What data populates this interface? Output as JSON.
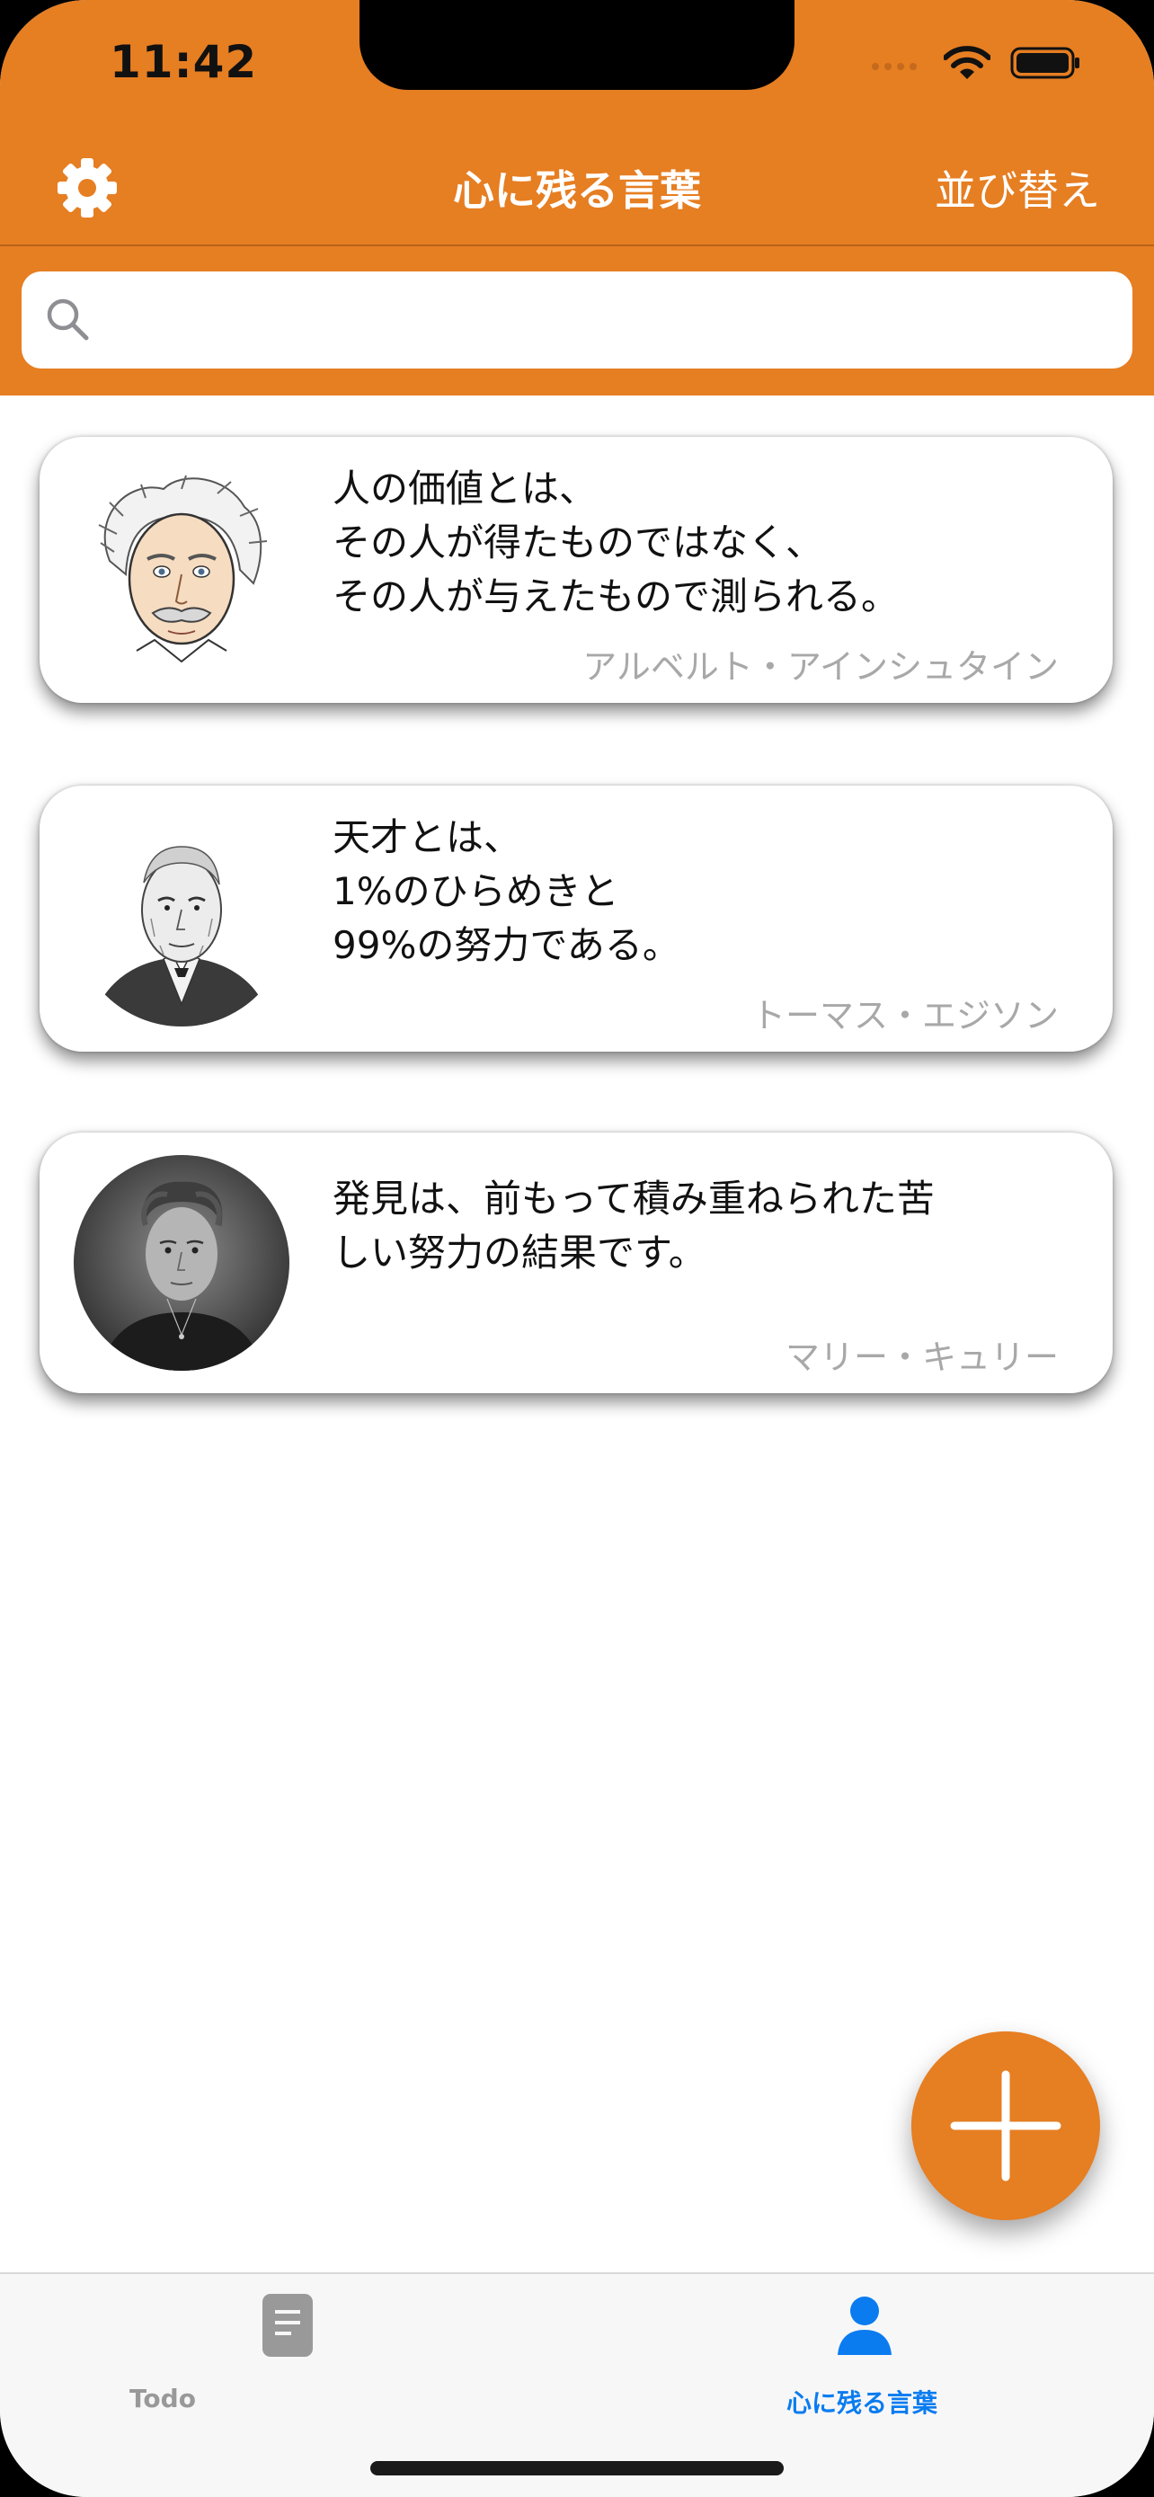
{
  "status_bar": {
    "time": "11:42"
  },
  "nav": {
    "title": "心に残る言葉",
    "sort_label": "並び替え"
  },
  "search": {
    "value": "",
    "placeholder": ""
  },
  "quotes": [
    {
      "lines": [
        "人の価値とは、",
        "その人が得たものではなく、",
        "その人が与えたもので測られる。"
      ],
      "author": "アルベルト・アインシュタイン"
    },
    {
      "lines": [
        "天才とは、",
        "1%のひらめきと",
        "99%の努力である。"
      ],
      "author": "トーマス・エジソン"
    },
    {
      "lines": [
        "発見は、前もって積み重ねられた苦",
        "しい努力の結果です。"
      ],
      "author": "マリー・キュリー"
    }
  ],
  "tabbar": {
    "tabs": [
      {
        "label": "Todo",
        "icon": "document-icon",
        "active": false
      },
      {
        "label": "心に残る言葉",
        "icon": "person-icon",
        "active": true
      }
    ]
  },
  "colors": {
    "accent": "#e67e22",
    "tab_active": "#0a7cf0",
    "tab_inactive": "#999999",
    "author_text": "#a8a8a8"
  }
}
